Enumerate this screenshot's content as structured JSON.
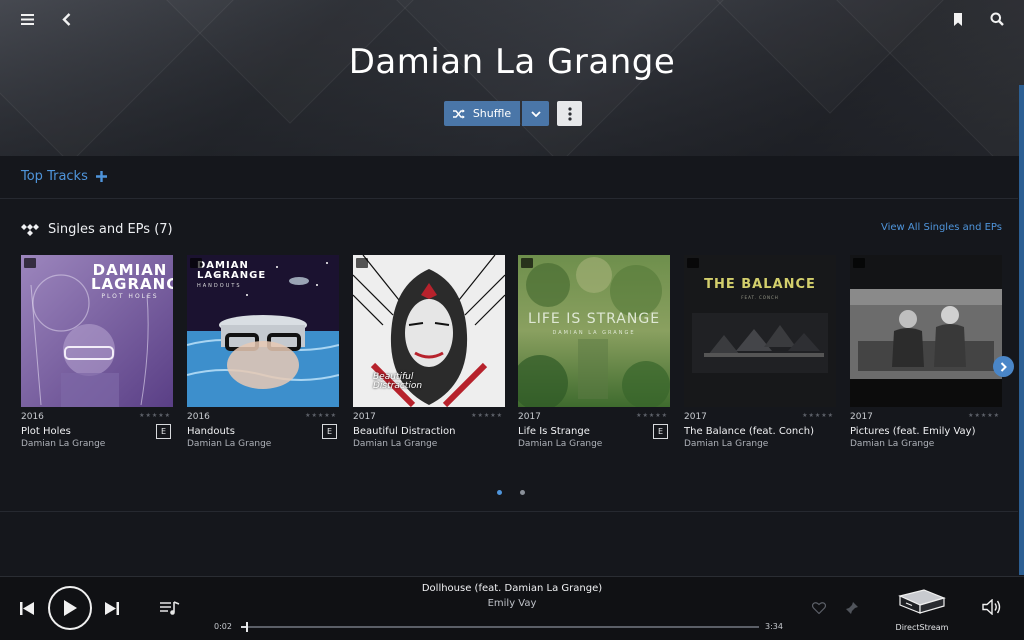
{
  "header": {
    "artist_name": "Damian La Grange",
    "shuffle_label": "Shuffle"
  },
  "top_tracks": {
    "label": "Top Tracks"
  },
  "singles": {
    "heading": "Singles and EPs (7)",
    "view_all": "View All Singles and EPs",
    "albums": [
      {
        "year": "2016",
        "title": "Plot Holes",
        "artist": "Damian La Grange",
        "explicit": "E",
        "cover_text": "DAMIAN LAGRANGE",
        "cover_sub": "PLOT HOLES",
        "cover_color": "#8b6aa8"
      },
      {
        "year": "2016",
        "title": "Handouts",
        "artist": "Damian La Grange",
        "explicit": "E",
        "cover_text": "DAMIAN LAGRANGE",
        "cover_sub": "HANDOUTS",
        "cover_color": "#3f8cc4"
      },
      {
        "year": "2017",
        "title": "Beautiful Distraction",
        "artist": "Damian La Grange",
        "explicit": "",
        "cover_text": "Beautiful Distraction",
        "cover_sub": "",
        "cover_color": "#b7222c"
      },
      {
        "year": "2017",
        "title": "Life Is Strange",
        "artist": "Damian La Grange",
        "explicit": "E",
        "cover_text": "LIFE IS STRANGE",
        "cover_sub": "DAMIAN LA GRANGE",
        "cover_color": "#4f7d3a"
      },
      {
        "year": "2017",
        "title": "The Balance (feat. Conch)",
        "artist": "Damian La Grange",
        "explicit": "",
        "cover_text": "THE BALANCE",
        "cover_sub": "FEAT. CONCH",
        "cover_color": "#1c1d1f"
      },
      {
        "year": "2017",
        "title": "Pictures (feat. Emily Vay)",
        "artist": "Damian La Grange",
        "explicit": "",
        "cover_text": "",
        "cover_sub": "",
        "cover_color": "#5a5a5a"
      }
    ],
    "rating_glyph": "★★★★★"
  },
  "pagination": {
    "pages": 2,
    "active": 0
  },
  "player": {
    "track_title": "Dollhouse (feat. Damian La Grange)",
    "track_artist": "Emily Vay",
    "elapsed": "0:02",
    "duration": "3:34",
    "progress": 0.01,
    "device": "DirectStream"
  },
  "colors": {
    "accent": "#4a76a8",
    "link": "#4f95db",
    "dot_active": "#4f95db",
    "dot_inactive": "#8a9099"
  }
}
